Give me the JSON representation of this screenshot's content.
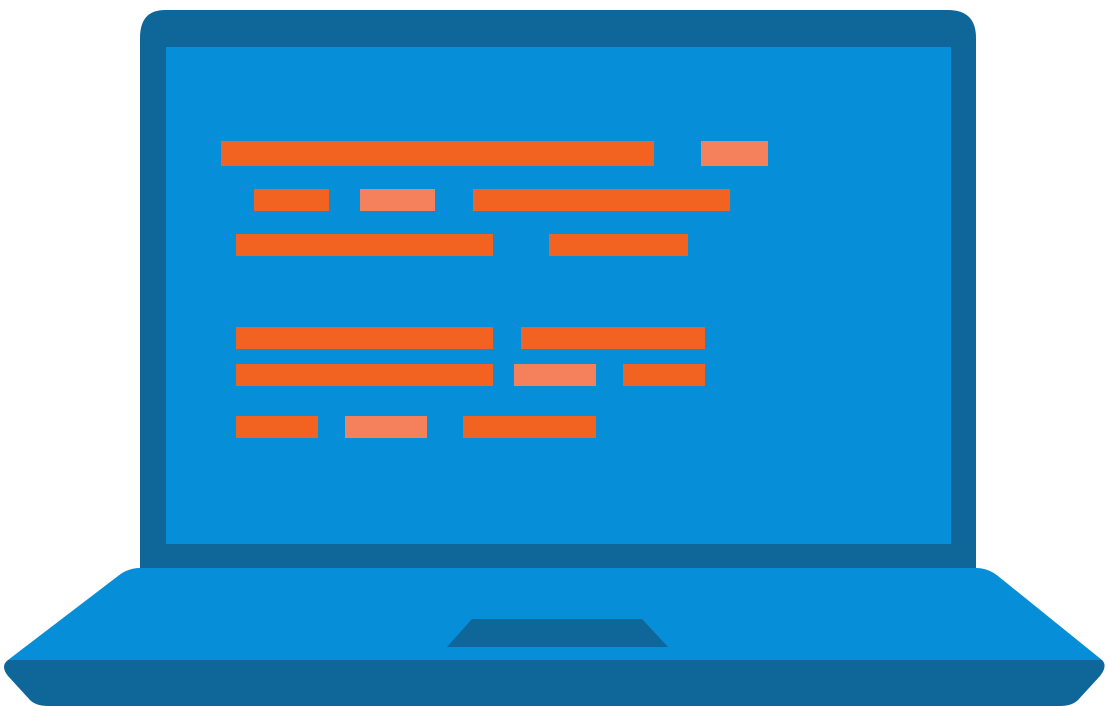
{
  "colors": {
    "background": "#ffffff",
    "bezel": "#0f6698",
    "screen": "#068fd8",
    "deck": "#068fd8",
    "deck_front": "#0f6698",
    "trackpad": "#0f6698",
    "code_primary": "#f26322",
    "code_secondary": "#f5805c"
  },
  "illustration": {
    "subject": "laptop-icon",
    "screen_content": "code-lines-icon",
    "code_lines": [
      {
        "tokens": [
          "primary",
          "secondary"
        ]
      },
      {
        "tokens": [
          "primary",
          "secondary",
          "primary"
        ]
      },
      {
        "tokens": [
          "primary",
          "primary"
        ]
      },
      {
        "tokens": [
          "primary",
          "primary"
        ]
      },
      {
        "tokens": [
          "primary",
          "secondary",
          "primary"
        ]
      },
      {
        "tokens": [
          "primary",
          "secondary",
          "primary"
        ]
      }
    ]
  }
}
